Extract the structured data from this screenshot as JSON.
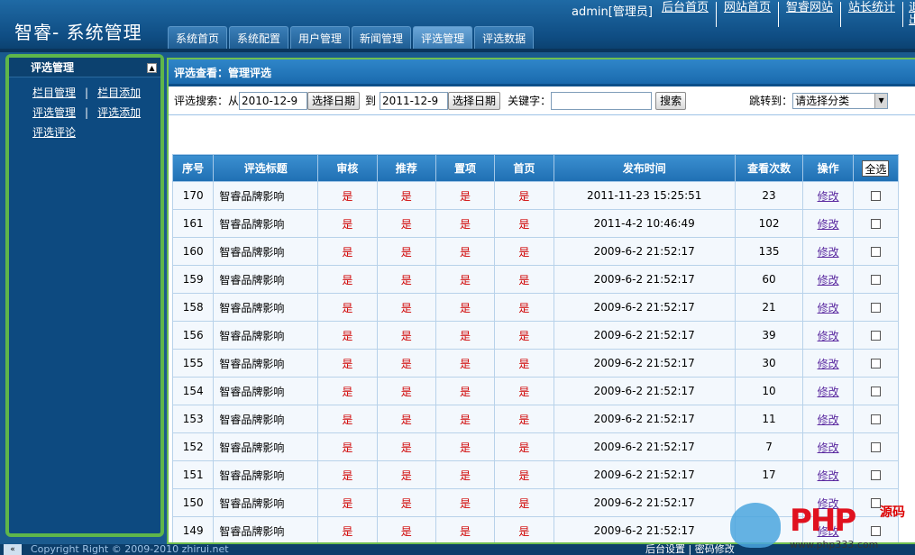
{
  "header": {
    "brand": "智睿- 系统管理",
    "user": "admin[管理员]",
    "links": [
      "后台首页",
      "网站首页",
      "智睿网站",
      "站长统计"
    ],
    "exit": "退出"
  },
  "nav": {
    "tabs": [
      "系统首页",
      "系统配置",
      "用户管理",
      "新闻管理",
      "评选管理",
      "评选数据"
    ],
    "active": 4
  },
  "sidebar": {
    "title": "评选管理",
    "collapse": "▲",
    "items": [
      [
        "栏目管理",
        "栏目添加"
      ],
      [
        "评选管理",
        "评选添加"
      ],
      [
        "评选评论"
      ]
    ]
  },
  "main": {
    "title": "评选查看：管理评选",
    "search": {
      "label": "评选搜索：从",
      "from": "2010-12-9",
      "pick_date": "选择日期",
      "to_label": "到",
      "to": "2011-12-9",
      "keyword_label": "关键字：",
      "keyword": "",
      "search_btn": "搜索",
      "jump_label": "跳转到：",
      "select": "请选择分类"
    },
    "columns": [
      "序号",
      "评选标题",
      "审核",
      "推荐",
      "置项",
      "首页",
      "发布时间",
      "查看次数",
      "操作"
    ],
    "select_all": "全选",
    "edit_label": "修改",
    "rows": [
      {
        "id": "170",
        "title": "智睿品牌影响",
        "audit": "是",
        "rec": "是",
        "top": "是",
        "home": "是",
        "time": "2011-11-23 15:25:51",
        "views": "23"
      },
      {
        "id": "161",
        "title": "智睿品牌影响",
        "audit": "是",
        "rec": "是",
        "top": "是",
        "home": "是",
        "time": "2011-4-2 10:46:49",
        "views": "102"
      },
      {
        "id": "160",
        "title": "智睿品牌影响",
        "audit": "是",
        "rec": "是",
        "top": "是",
        "home": "是",
        "time": "2009-6-2 21:52:17",
        "views": "135"
      },
      {
        "id": "159",
        "title": "智睿品牌影响",
        "audit": "是",
        "rec": "是",
        "top": "是",
        "home": "是",
        "time": "2009-6-2 21:52:17",
        "views": "60"
      },
      {
        "id": "158",
        "title": "智睿品牌影响",
        "audit": "是",
        "rec": "是",
        "top": "是",
        "home": "是",
        "time": "2009-6-2 21:52:17",
        "views": "21"
      },
      {
        "id": "156",
        "title": "智睿品牌影响",
        "audit": "是",
        "rec": "是",
        "top": "是",
        "home": "是",
        "time": "2009-6-2 21:52:17",
        "views": "39"
      },
      {
        "id": "155",
        "title": "智睿品牌影响",
        "audit": "是",
        "rec": "是",
        "top": "是",
        "home": "是",
        "time": "2009-6-2 21:52:17",
        "views": "30"
      },
      {
        "id": "154",
        "title": "智睿品牌影响",
        "audit": "是",
        "rec": "是",
        "top": "是",
        "home": "是",
        "time": "2009-6-2 21:52:17",
        "views": "10"
      },
      {
        "id": "153",
        "title": "智睿品牌影响",
        "audit": "是",
        "rec": "是",
        "top": "是",
        "home": "是",
        "time": "2009-6-2 21:52:17",
        "views": "11"
      },
      {
        "id": "152",
        "title": "智睿品牌影响",
        "audit": "是",
        "rec": "是",
        "top": "是",
        "home": "是",
        "time": "2009-6-2 21:52:17",
        "views": "7"
      },
      {
        "id": "151",
        "title": "智睿品牌影响",
        "audit": "是",
        "rec": "是",
        "top": "是",
        "home": "是",
        "time": "2009-6-2 21:52:17",
        "views": "17"
      },
      {
        "id": "150",
        "title": "智睿品牌影响",
        "audit": "是",
        "rec": "是",
        "top": "是",
        "home": "是",
        "time": "2009-6-2 21:52:17",
        "views": ""
      },
      {
        "id": "149",
        "title": "智睿品牌影响",
        "audit": "是",
        "rec": "是",
        "top": "是",
        "home": "是",
        "time": "2009-6-2 21:52:17",
        "views": ""
      }
    ]
  },
  "footer": {
    "back": "«",
    "copyright": "Copyright Right © 2009-2010 zhirui.net",
    "right": "后台设置 | 密码修改"
  },
  "watermark": {
    "logo": "PHP",
    "sub": "源码",
    "url": "www.php333.com"
  },
  "colors": {
    "header": "#0f4d83",
    "sidebar": "#0d4a80",
    "frame": "#5fb64a",
    "yes": "#d00000",
    "edit": "#5b2aa0"
  }
}
